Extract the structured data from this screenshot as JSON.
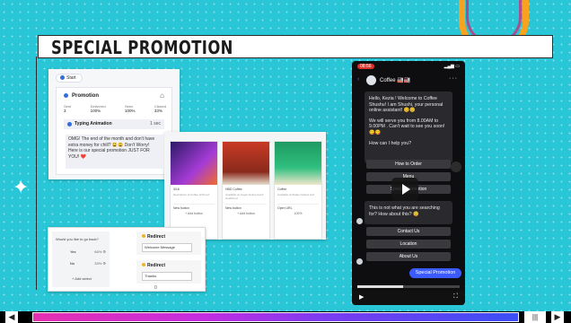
{
  "slide": {
    "title": "SPECIAL PROMOTION"
  },
  "flow_editor": {
    "start_label": "Start",
    "promo_label": "Promotion",
    "stats": [
      {
        "label": "Sent",
        "value": "3"
      },
      {
        "label": "Delivered",
        "value": "100%"
      },
      {
        "label": "Seen",
        "value": "100%"
      },
      {
        "label": "Clicked",
        "value": "33%"
      }
    ],
    "typing_label": "Typing Animation",
    "typing_duration": "1 sec",
    "message": "OMG! The end of the month and don't have extra money for chill? 😩😩 Don't Worry! Here is our special promotion JUST FOR YOU! ❤️"
  },
  "carousel": {
    "cards": [
      {
        "title": "3/16",
        "desc": "Description of Coffee 3/16 text",
        "button": "New button",
        "button2": "+ Add button"
      },
      {
        "title": "HBD Coffee",
        "desc": "Available on Gojek GoFood and GrabFood",
        "button": "New button",
        "button2": "+ Add button"
      },
      {
        "title": "Coffee",
        "desc": "Available at Shake Outlets and",
        "button": "Open URL",
        "button2": "100%"
      }
    ]
  },
  "branch": {
    "question": "Would you like to go back?",
    "options": [
      {
        "label": "Yes",
        "pct": "66% ⚙"
      },
      {
        "label": "No",
        "pct": "33% ⚙"
      }
    ],
    "add_label": "+ Add select",
    "count": "0",
    "redirects": [
      {
        "label": "Redirect",
        "target": "Welcome Message"
      },
      {
        "label": "Redirect",
        "target": "Thanks"
      }
    ]
  },
  "phone": {
    "rec": "08:56",
    "chat_name": "Coffee 🏭🏭",
    "greeting": "Hello, Kezia ! Welcome to Coffee Shushu! I am Shushi, your personal online assistant! 😊😊",
    "hours": "We will serve you from 8.00AM to 9.00PM . Can't wait to see you soon!😋😋",
    "help": "How can I help you?",
    "quick_replies": [
      "How to Order",
      "Menu",
      "Special Promotion"
    ],
    "not_found": "This is not what you are searching for? How about this? 😊",
    "more_replies": [
      "Contact Us",
      "Location",
      "About Us"
    ],
    "user_reply": "Special Promotion"
  },
  "player": {
    "progress": 0.45
  },
  "colors": {
    "slide_bg": "#28c6d6",
    "arch": "#f7a320",
    "accent_blue": "#3b5bff"
  }
}
